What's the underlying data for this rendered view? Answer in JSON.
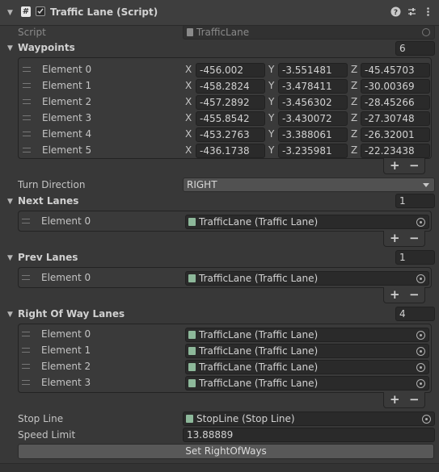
{
  "component": {
    "title": "Traffic Lane (Script)",
    "help_icon": "help-icon",
    "presets_icon": "presets-icon",
    "menu_icon": "kebab-menu-icon"
  },
  "script_field": {
    "label": "Script",
    "value": "TrafficLane"
  },
  "waypoints": {
    "label": "Waypoints",
    "size": "6",
    "elements": [
      {
        "label": "Element 0",
        "x": "-456.002",
        "y": "-3.551481",
        "z": "-45.45703"
      },
      {
        "label": "Element 1",
        "x": "-458.2824",
        "y": "-3.478411",
        "z": "-30.00369"
      },
      {
        "label": "Element 2",
        "x": "-457.2892",
        "y": "-3.456302",
        "z": "-28.45266"
      },
      {
        "label": "Element 3",
        "x": "-455.8542",
        "y": "-3.430072",
        "z": "-27.30748"
      },
      {
        "label": "Element 4",
        "x": "-453.2763",
        "y": "-3.388061",
        "z": "-26.32001"
      },
      {
        "label": "Element 5",
        "x": "-436.1738",
        "y": "-3.235981",
        "z": "-22.23438"
      }
    ],
    "axis_labels": [
      "X",
      "Y",
      "Z"
    ]
  },
  "turn_direction": {
    "label": "Turn Direction",
    "value": "RIGHT"
  },
  "next_lanes": {
    "label": "Next Lanes",
    "size": "1",
    "elements": [
      {
        "label": "Element 0",
        "value": "TrafficLane (Traffic Lane)"
      }
    ]
  },
  "prev_lanes": {
    "label": "Prev Lanes",
    "size": "1",
    "elements": [
      {
        "label": "Element 0",
        "value": "TrafficLane (Traffic Lane)"
      }
    ]
  },
  "right_of_way_lanes": {
    "label": "Right Of Way Lanes",
    "size": "4",
    "elements": [
      {
        "label": "Element 0",
        "value": "TrafficLane (Traffic Lane)"
      },
      {
        "label": "Element 1",
        "value": "TrafficLane (Traffic Lane)"
      },
      {
        "label": "Element 2",
        "value": "TrafficLane (Traffic Lane)"
      },
      {
        "label": "Element 3",
        "value": "TrafficLane (Traffic Lane)"
      }
    ]
  },
  "list_controls": {
    "add": "+",
    "remove": "−"
  },
  "stop_line": {
    "label": "Stop Line",
    "value": "StopLine (Stop Line)"
  },
  "speed_limit": {
    "label": "Speed Limit",
    "value": "13.88889"
  },
  "set_button": {
    "label": "Set RightOfWays"
  },
  "colors": {
    "background": "#383838",
    "field": "#2a2a2a",
    "text": "#c4c4c4"
  }
}
